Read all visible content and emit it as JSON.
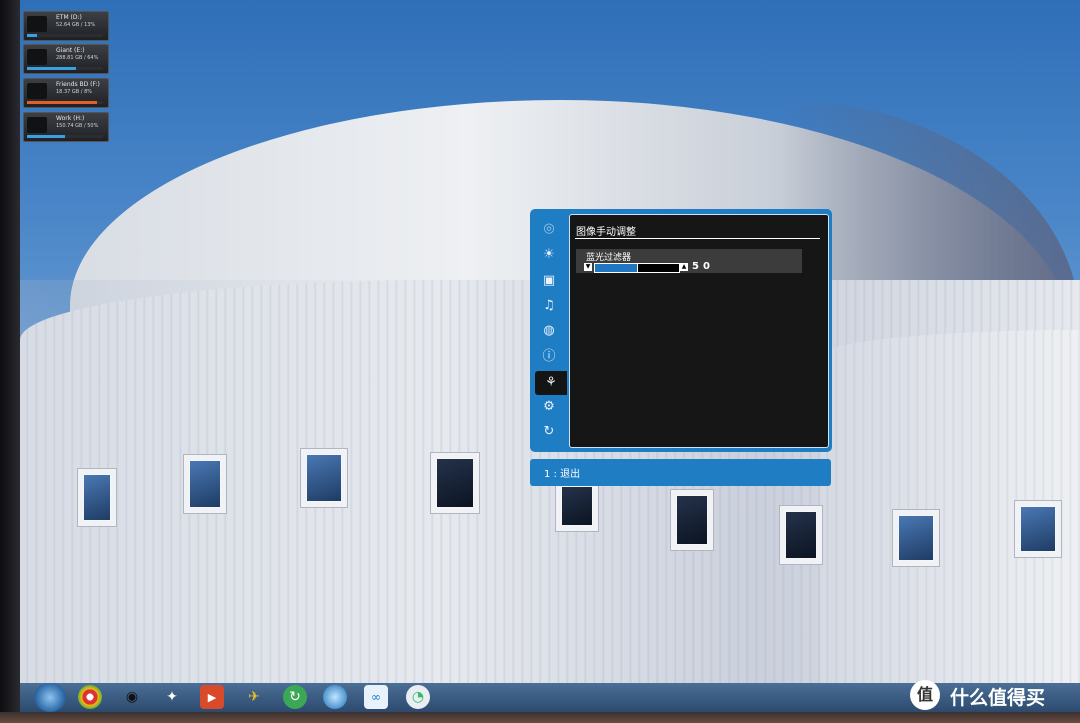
{
  "drives": [
    {
      "name": "ETM (D:)",
      "stats": "52.64 GB / 13%",
      "usage": 0.13,
      "bar_color": "#3aa0e0"
    },
    {
      "name": "Giant (E:)",
      "stats": "288.81 GB / 64%",
      "usage": 0.64,
      "bar_color": "#3aa0e0"
    },
    {
      "name": "Friends BD (F:)",
      "stats": "18.37 GB / 8%",
      "usage": 0.92,
      "bar_color": "#e0602a"
    },
    {
      "name": "Work (H:)",
      "stats": "150.74 GB / 50%",
      "usage": 0.5,
      "bar_color": "#3aa0e0"
    }
  ],
  "osd": {
    "menu_title": "图像手动调整",
    "setting_label": "蓝光过滤器",
    "value": "50",
    "slider_level": 0.5,
    "footer_hint": "1 : 退出",
    "accent_color": "#1f7dc4",
    "side_icons": [
      "picture-icon",
      "brightness-icon",
      "display-icon",
      "audio-icon",
      "color-palette-icon",
      "info-icon",
      "manual-image-adjust-icon",
      "settings-icon",
      "reset-icon"
    ],
    "selected_icon": "manual-image-adjust-icon"
  },
  "taskbar": {
    "apps": [
      "chrome-icon",
      "qq-icon",
      "fox-icon",
      "media-player-icon",
      "bird-icon",
      "refresh-app-icon",
      "blue-ball-icon",
      "link-app-icon",
      "clock-app-icon"
    ]
  },
  "watermark": {
    "glyph": "值",
    "text": "什么值得买"
  }
}
